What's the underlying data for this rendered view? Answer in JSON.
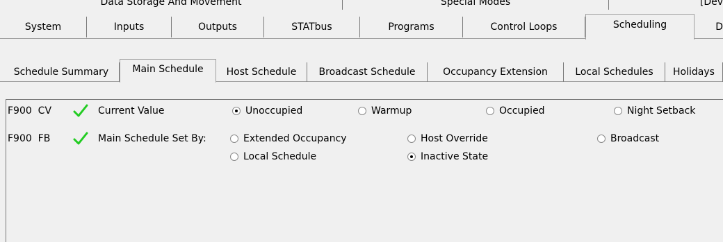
{
  "top_tabs": [
    "Data Storage And Movement",
    "Special Modes",
    "[Dev"
  ],
  "main_tabs": [
    {
      "label": "System"
    },
    {
      "label": "Inputs"
    },
    {
      "label": "Outputs"
    },
    {
      "label": "STATbus"
    },
    {
      "label": "Programs"
    },
    {
      "label": "Control Loops"
    },
    {
      "label": "Scheduling",
      "selected": true
    },
    {
      "label": "D"
    }
  ],
  "sub_tabs": [
    {
      "label": "Schedule Summary"
    },
    {
      "label": "Main Schedule",
      "selected": true
    },
    {
      "label": "Host Schedule"
    },
    {
      "label": "Broadcast Schedule"
    },
    {
      "label": "Occupancy Extension"
    },
    {
      "label": "Local Schedules"
    },
    {
      "label": "Holidays"
    }
  ],
  "rows": [
    {
      "id": "F900  CV",
      "check_color": "#22cc22",
      "label": "Current Value",
      "options": [
        {
          "label": "Unoccupied",
          "checked": true
        },
        {
          "label": "Warmup",
          "checked": false
        },
        {
          "label": "Occupied",
          "checked": false
        },
        {
          "label": "Night Setback",
          "checked": false
        }
      ]
    },
    {
      "id": "F900  FB",
      "check_color": "#22cc22",
      "label": "Main Schedule Set By:",
      "options": [
        {
          "label": "Extended Occupancy",
          "checked": false
        },
        {
          "label": "Host Override",
          "checked": false
        },
        {
          "label": "Broadcast",
          "checked": false
        },
        {
          "label": "Local Schedule",
          "checked": false
        },
        {
          "label": "Inactive State",
          "checked": true
        }
      ]
    }
  ]
}
